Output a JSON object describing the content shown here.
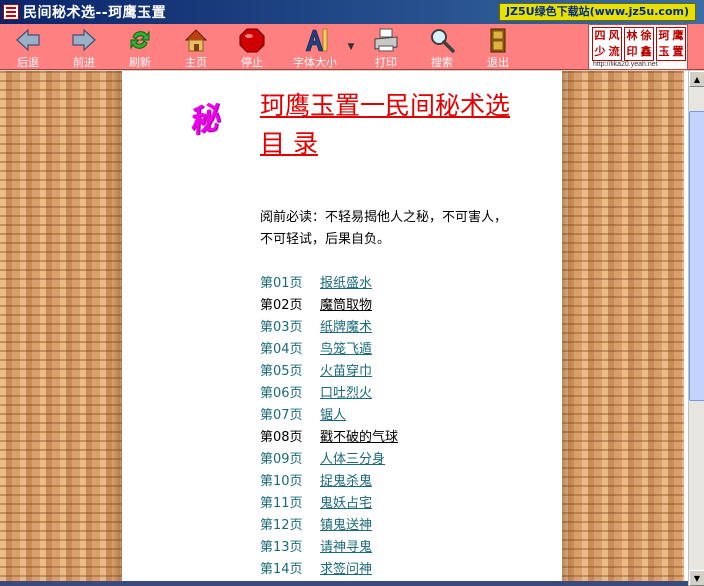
{
  "window": {
    "title": "民间秘术选--珂鹰玉置",
    "brand_badge": "JZ5U绿色下载站(www.jz5u.com)"
  },
  "toolbar": {
    "back": "后退",
    "forward": "前进",
    "refresh": "刷新",
    "home": "主页",
    "stop": "停止",
    "font_size": "字体大小",
    "print": "打印",
    "search": "搜索",
    "exit": "退出"
  },
  "stamp": {
    "chars": [
      "四",
      "风",
      "少",
      "流",
      "林",
      "徐",
      "印",
      "鑫",
      "珂",
      "鹰",
      "玉",
      "置"
    ],
    "url": "http://lika20.yeah.net"
  },
  "page": {
    "secret_glyph": "秘",
    "headline_1": "珂鹰玉置一民间秘术选",
    "headline_2": "目 录",
    "notice_1": "阅前必读：不轻易揭他人之秘，不可害人，",
    "notice_2": "不可轻试，后果自负。",
    "toc": [
      {
        "num": "第01页",
        "title": "报纸盛水",
        "visited": false
      },
      {
        "num": "第02页",
        "title": "魔筒取物",
        "visited": true
      },
      {
        "num": "第03页",
        "title": "纸牌魔术",
        "visited": false
      },
      {
        "num": "第04页",
        "title": "鸟笼飞遁",
        "visited": false
      },
      {
        "num": "第05页",
        "title": "火苗穿巾",
        "visited": false
      },
      {
        "num": "第06页",
        "title": "口吐烈火",
        "visited": false
      },
      {
        "num": "第07页",
        "title": "锯人",
        "visited": false
      },
      {
        "num": "第08页",
        "title": "戳不破的气球",
        "visited": true
      },
      {
        "num": "第09页",
        "title": "人体三分身",
        "visited": false
      },
      {
        "num": "第10页",
        "title": "捉鬼杀鬼",
        "visited": false
      },
      {
        "num": "第11页",
        "title": "鬼妖占宅",
        "visited": false
      },
      {
        "num": "第12页",
        "title": "镇鬼送神",
        "visited": false
      },
      {
        "num": "第13页",
        "title": "请神寻鬼",
        "visited": false
      },
      {
        "num": "第14页",
        "title": "求签问神",
        "visited": false
      }
    ]
  },
  "colors": {
    "titlebar": "#0a246a",
    "toolbar": "#ff8080",
    "headline": "#e00000",
    "link": "#1a6a7a",
    "texture": "#d9a06c"
  }
}
